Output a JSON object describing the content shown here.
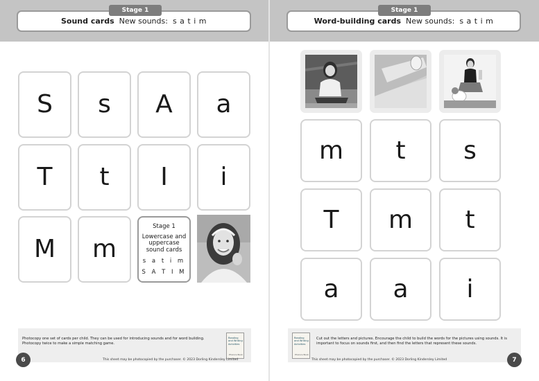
{
  "left_page": {
    "stage_tab": "Stage 1",
    "title": "Sound cards",
    "new_sounds_label": "New sounds:",
    "new_sounds": "s a t i m",
    "cards": [
      "S",
      "s",
      "A",
      "a",
      "T",
      "t",
      "I",
      "i",
      "M",
      "m"
    ],
    "info_card": {
      "stage": "Stage 1",
      "description": "Lowercase and uppercase sound cards",
      "lowercase": "s a t i m",
      "uppercase": "S A T I M"
    },
    "footer_text": "Photocopy one set of cards per child. They can be used for introducing sounds and for word building. Photocopy twice to make a simple matching game.",
    "copyright": "This sheet may be photocopied by the purchaser. © 2023 Dorling Kindersley Limited",
    "page_number": "6"
  },
  "right_page": {
    "stage_tab": "Stage 1",
    "title": "Word-building cards",
    "new_sounds_label": "New sounds:",
    "new_sounds": "s a t i m",
    "cards": [
      "m",
      "t",
      "s",
      "T",
      "m",
      "t",
      "a",
      "a",
      "i"
    ],
    "footer_text": "Cut out the letters and pictures. Encourage the child to build the words for the pictures using sounds. It is important to focus on sounds first, and then find the letters that represent these sounds.",
    "copyright": "This sheet may be photocopied by the purchaser. © 2023 Dorling Kindersley Limited",
    "page_number": "7"
  },
  "book_thumbnail": {
    "title": "Reading and Writing Activities",
    "subtitle": "Phonics Book"
  },
  "colors": {
    "band": "#c4c4c4",
    "tab": "#7d7d7d",
    "card_border": "#d3d3d3",
    "page_number_bg": "#4a4a4a"
  }
}
